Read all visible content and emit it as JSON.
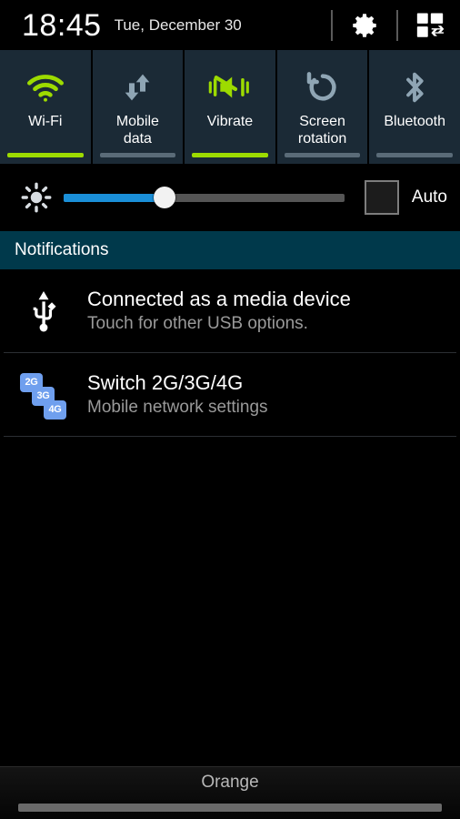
{
  "statusbar": {
    "time": "18:45",
    "date": "Tue, December 30",
    "settings_icon": "gear-icon",
    "quick_panel_icon": "multi-window-icon"
  },
  "quick_toggles": [
    {
      "label": "Wi-Fi",
      "icon": "wifi-icon",
      "state": "on",
      "bar_color": "#9ddb00"
    },
    {
      "label": "Mobile\ndata",
      "icon": "mobile-data-icon",
      "state": "off",
      "bar_color": "#5a6b78"
    },
    {
      "label": "Vibrate",
      "icon": "vibrate-icon",
      "state": "on",
      "bar_color": "#9ddb00"
    },
    {
      "label": "Screen\nrotation",
      "icon": "screen-rotation-icon",
      "state": "off",
      "bar_color": "#5a6b78"
    },
    {
      "label": "Bluetooth",
      "icon": "bluetooth-icon",
      "state": "off",
      "bar_color": "#5a6b78"
    }
  ],
  "brightness": {
    "icon": "brightness-icon",
    "value_percent": 36,
    "fill_color": "#1a8fd8",
    "track_color": "#555555",
    "auto_label": "Auto",
    "auto_checked": false
  },
  "notifications": {
    "header": "Notifications",
    "header_color": "#00394b",
    "items": [
      {
        "icon": "usb-icon",
        "title": "Connected as a media device",
        "subtitle": "Touch for other USB options."
      },
      {
        "icon": "network-2g3g4g-icon",
        "title": "Switch 2G/3G/4G",
        "subtitle": "Mobile network settings",
        "badges": [
          "2G",
          "3G",
          "4G"
        ],
        "badge_color": "#6f9fee"
      }
    ]
  },
  "carrier": {
    "name": "Orange",
    "handle": "drag-handle"
  }
}
